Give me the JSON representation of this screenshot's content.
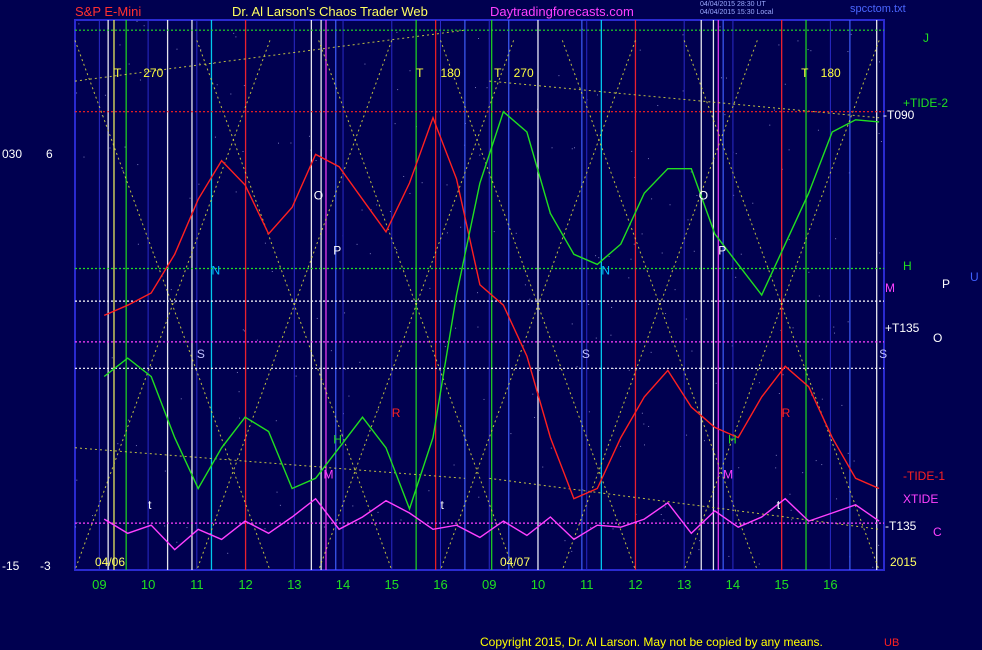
{
  "header": {
    "symbol": "S&P E-Mini",
    "title": "Dr. Al Larson's Chaos Trader Web",
    "site": "Daytradingforecasts.com",
    "stamp_line1": "04/04/2015 28:30 UT",
    "stamp_line2": "04/04/2015 15:30 Local",
    "file": "spcctom.txt"
  },
  "left_axis": {
    "top_left": "030",
    "top_right": "6",
    "bottom_left": "-15",
    "bottom_right": "-3"
  },
  "right_labels": {
    "J": "J",
    "tide2": "+TIDE-2",
    "t090": "-T090",
    "H": "H",
    "M": "M",
    "P": "P",
    "U": "U",
    "t135p": "+T135",
    "O": "O",
    "tide1": "-TIDE-1",
    "xtide": "XTIDE",
    "t135m": "-T135",
    "C": "C"
  },
  "date_labels": {
    "first": "04/06",
    "second": "04/07",
    "year": "2015"
  },
  "copyright": "Copyright 2015, Dr. Al Larson. May not be copied by any means.",
  "corner_mark": "UB",
  "colors": {
    "bg": "#000050",
    "grid": "#2020b0",
    "red": "#ff2020",
    "green": "#20e020",
    "magenta": "#ff40ff",
    "yellow": "#ffff40"
  },
  "chart_data": {
    "type": "line",
    "title": "S&P E-Mini",
    "x_tick_labels": [
      "09",
      "10",
      "11",
      "12",
      "13",
      "14",
      "15",
      "16",
      "09",
      "10",
      "11",
      "12",
      "13",
      "14",
      "15",
      "16"
    ],
    "y_left_labels": [
      "030",
      "6",
      "-15",
      "-3"
    ],
    "series": [
      {
        "name": "TIDE-1",
        "color": "#ff2020",
        "values": [
          -2.5,
          -2,
          -1.4,
          0.5,
          3.2,
          5.1,
          3.9,
          1.5,
          2.8,
          5.4,
          4.8,
          3.2,
          1.6,
          4.0,
          7.2,
          4.2,
          -1.0,
          -2.0,
          -4.5,
          -8.5,
          -11.5,
          -11.0,
          -8.5,
          -6.5,
          -5.2,
          -7.0,
          -8.0,
          -8.5,
          -6.5,
          -5.0,
          -6.0,
          -8.5,
          -10.5,
          -11.0
        ]
      },
      {
        "name": "TIDE-2",
        "color": "#20e020",
        "values": [
          -5.5,
          -4.6,
          -5.5,
          -8.5,
          -11.0,
          -9.0,
          -7.5,
          -8.2,
          -11.0,
          -10.5,
          -9.0,
          -7.5,
          -9.0,
          -12.0,
          -8.5,
          -1.5,
          4.0,
          7.5,
          6.5,
          2.5,
          0.5,
          0.0,
          1.0,
          3.5,
          4.7,
          4.7,
          1.5,
          0.0,
          -1.5,
          1.0,
          3.5,
          6.5,
          7.1,
          7.0
        ]
      },
      {
        "name": "XTIDE",
        "color": "#ff40ff",
        "values": [
          -12.5,
          -13.2,
          -12.8,
          -14.0,
          -13.0,
          -13.5,
          -12.6,
          -13.2,
          -12.4,
          -11.5,
          -13.0,
          -12.4,
          -11.6,
          -12.2,
          -13.0,
          -12.8,
          -13.4,
          -12.6,
          -13.3,
          -12.4,
          -13.5,
          -12.8,
          -12.9,
          -12.5,
          -11.7,
          -13.2,
          -12.1,
          -12.9,
          -12.4,
          -11.5,
          -12.6,
          -12.2,
          -11.8,
          -12.6
        ]
      }
    ],
    "flat_lines": [
      {
        "name": "M",
        "value": -3.8,
        "color": "#ff40ff"
      },
      {
        "name": "white line",
        "value": -1.8,
        "color": "#ffffff"
      },
      {
        "name": "+T135",
        "value": -5.1,
        "color": "#ffffff"
      },
      {
        "name": "-T135",
        "value": -12.7,
        "color": "#ff40ff"
      },
      {
        "name": "H",
        "value": -0.2,
        "color": "#20e020"
      },
      {
        "name": "J",
        "value": 11.5,
        "color": "#20e020"
      },
      {
        "name": "T090",
        "value": 7.5,
        "color": "#ff2020"
      }
    ],
    "series_labels": [
      {
        "text": "T",
        "x": 0.3,
        "y": 9.2,
        "color": "#ffff40"
      },
      {
        "text": "270",
        "x": 0.9,
        "y": 9.2,
        "color": "#ffff40"
      },
      {
        "text": "T",
        "x": 6.5,
        "y": 9.2,
        "color": "#ffff40"
      },
      {
        "text": "180",
        "x": 7.0,
        "y": 9.2,
        "color": "#ffff40"
      },
      {
        "text": "T",
        "x": 8.1,
        "y": 9.2,
        "color": "#ffff40"
      },
      {
        "text": "270",
        "x": 8.5,
        "y": 9.2,
        "color": "#ffff40"
      },
      {
        "text": "T",
        "x": 14.4,
        "y": 9.2,
        "color": "#ffff40"
      },
      {
        "text": "180",
        "x": 14.8,
        "y": 9.2,
        "color": "#ffff40"
      },
      {
        "text": "O",
        "x": 4.4,
        "y": 3.2,
        "color": "#ffffff"
      },
      {
        "text": "O",
        "x": 12.3,
        "y": 3.2,
        "color": "#ffffff"
      },
      {
        "text": "P",
        "x": 4.8,
        "y": 0.5,
        "color": "#ffffff"
      },
      {
        "text": "P",
        "x": 12.7,
        "y": 0.5,
        "color": "#ffffff"
      },
      {
        "text": "N",
        "x": 2.3,
        "y": -0.5,
        "color": "#00c0ff"
      },
      {
        "text": "N",
        "x": 10.3,
        "y": -0.5,
        "color": "#00c0ff"
      },
      {
        "text": "S",
        "x": 2.0,
        "y": -4.6,
        "color": "#c0c0ff"
      },
      {
        "text": "S",
        "x": 9.9,
        "y": -4.6,
        "color": "#c0c0ff"
      },
      {
        "text": "S",
        "x": 16.0,
        "y": -4.6,
        "color": "#c0c0ff"
      },
      {
        "text": "R",
        "x": 6.0,
        "y": -7.5,
        "color": "#ff2020"
      },
      {
        "text": "R",
        "x": 14.0,
        "y": -7.5,
        "color": "#ff2020"
      },
      {
        "text": "H",
        "x": 4.8,
        "y": -8.8,
        "color": "#20e020"
      },
      {
        "text": "H",
        "x": 12.9,
        "y": -8.8,
        "color": "#20e020"
      },
      {
        "text": "M",
        "x": 4.6,
        "y": -10.5,
        "color": "#ff40ff"
      },
      {
        "text": "M",
        "x": 12.8,
        "y": -10.5,
        "color": "#ff40ff"
      },
      {
        "text": "t",
        "x": 1.0,
        "y": -12.0,
        "color": "#ffffff"
      },
      {
        "text": "t",
        "x": 7.0,
        "y": -12.0,
        "color": "#ffffff"
      },
      {
        "text": "t",
        "x": 13.9,
        "y": -12.0,
        "color": "#ffffff"
      }
    ],
    "ylim": [
      -15,
      12
    ],
    "xlim": [
      -0.5,
      16.1
    ],
    "grid": true,
    "legend": "right"
  }
}
